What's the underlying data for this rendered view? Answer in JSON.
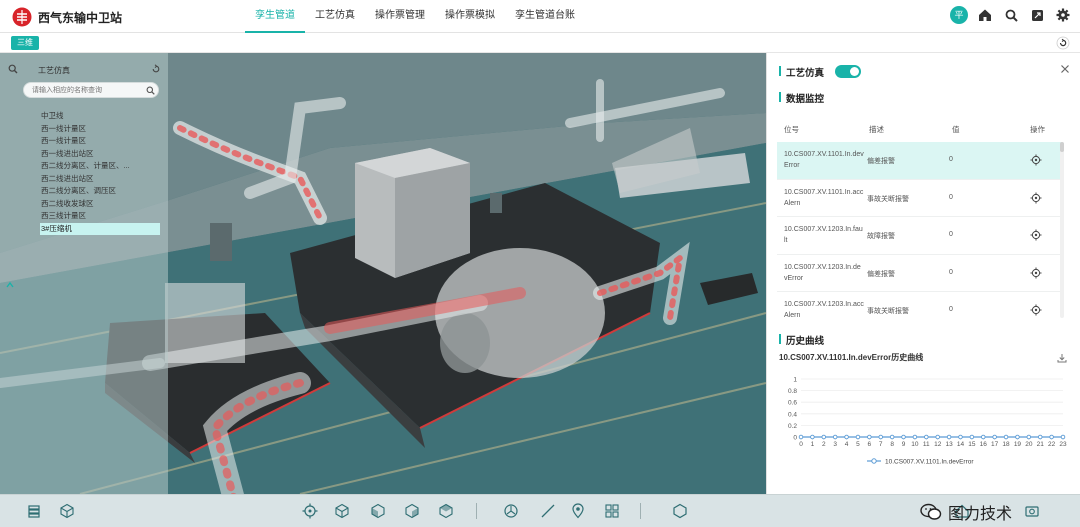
{
  "header": {
    "title": "西气东输中卫站",
    "nav": [
      {
        "label": "孪生管道",
        "active": true
      },
      {
        "label": "工艺仿真",
        "active": false
      },
      {
        "label": "操作票管理",
        "active": false
      },
      {
        "label": "操作票模拟",
        "active": false
      },
      {
        "label": "孪生管道台账",
        "active": false
      }
    ],
    "avatar_text": "平",
    "icons": [
      "home-icon",
      "search-icon",
      "fullscreen-icon",
      "settings-icon"
    ]
  },
  "subbar": {
    "mode_label": "三维"
  },
  "left_panel": {
    "title": "工艺仿真",
    "search_placeholder": "请输入相应的名称查询",
    "tree": [
      "中卫线",
      "西一线计量区",
      "西一线计量区",
      "西一线进出站区",
      "西二线分离区、计量区、...",
      "西二线进出站区",
      "西二线分离区、调压区",
      "西二线收发球区",
      "西三线计量区",
      "3#压缩机"
    ],
    "selected_index": 9
  },
  "right_panel": {
    "sim_title": "工艺仿真",
    "sim_enabled": true,
    "monitor_title": "数据监控",
    "table": {
      "headers": {
        "pos": "位号",
        "desc": "描述",
        "val": "值",
        "op": "操作"
      },
      "rows": [
        {
          "pos": "10.CS007.XV.1101.In.devError",
          "desc": "偏差报警",
          "val": "0"
        },
        {
          "pos": "10.CS007.XV.1101.In.accAlern",
          "desc": "事故关断报警",
          "val": "0"
        },
        {
          "pos": "10.CS007.XV.1203.In.fault",
          "desc": "故障报警",
          "val": "0"
        },
        {
          "pos": "10.CS007.XV.1203.In.devError",
          "desc": "偏差报警",
          "val": "0"
        },
        {
          "pos": "10.CS007.XV.1203.In.accAlern",
          "desc": "事故关断报警",
          "val": "0"
        }
      ],
      "highlight_index": 0
    },
    "history_title": "历史曲线",
    "chart_title": "10.CS007.XV.1101.In.devError历史曲线"
  },
  "chart_data": {
    "type": "line",
    "title": "10.CS007.XV.1101.In.devError历史曲线",
    "x": [
      0,
      1,
      2,
      3,
      4,
      5,
      6,
      7,
      8,
      9,
      10,
      11,
      12,
      13,
      14,
      15,
      16,
      17,
      18,
      19,
      20,
      21,
      22,
      23
    ],
    "series": [
      {
        "name": "10.CS007.XV.1101.In.devError",
        "values": [
          0,
          0,
          0,
          0,
          0,
          0,
          0,
          0,
          0,
          0,
          0,
          0,
          0,
          0,
          0,
          0,
          0,
          0,
          0,
          0,
          0,
          0,
          0,
          0
        ]
      }
    ],
    "y_ticks": [
      "0",
      "0.2",
      "0.4",
      "0.6",
      "0.8",
      "1"
    ],
    "ylim": [
      0,
      1
    ],
    "xlim": [
      0,
      23
    ],
    "grid": true,
    "legend": "bottom-center",
    "color": "#5b9bd5"
  },
  "watermark": {
    "text": "图力技术"
  },
  "colors": {
    "accent": "#19b3a9",
    "scene_floor": "#3f6f74",
    "pipe_red": "#e85a5a"
  }
}
